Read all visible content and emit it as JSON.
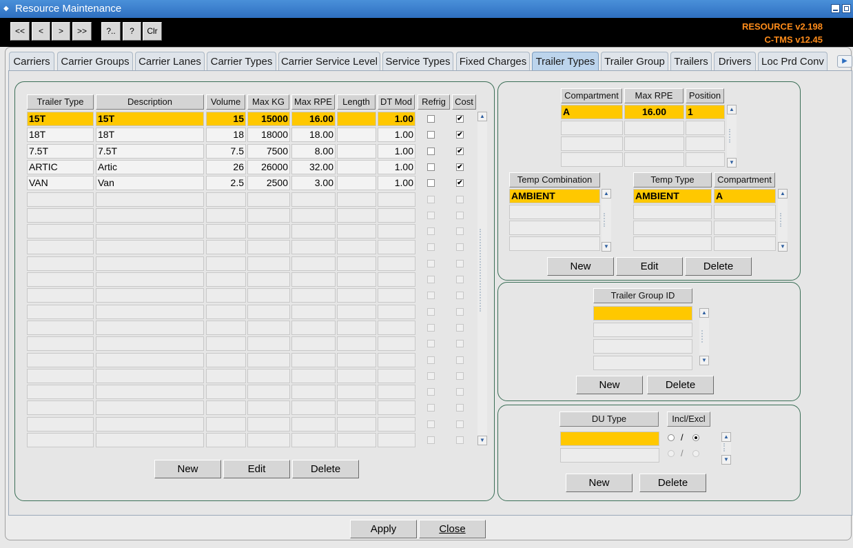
{
  "window": {
    "title": "Resource Maintenance"
  },
  "toolbar": {
    "buttons": [
      "<<",
      "<",
      ">",
      ">>",
      "?..",
      "?",
      "Clr"
    ],
    "version_line1": "RESOURCE v2.198",
    "version_line2": "C-TMS v12.45"
  },
  "tabs": [
    "Carriers",
    "Carrier Groups",
    "Carrier Lanes",
    "Carrier Types",
    "Carrier Service Level",
    "Service Types",
    "Fixed Charges",
    "Trailer Types",
    "Trailer Group",
    "Trailers",
    "Drivers",
    "Loc Prd Conv"
  ],
  "active_tab": "Trailer Types",
  "trailer_grid": {
    "headers": [
      "Trailer Type",
      "Description",
      "Volume",
      "Max KG",
      "Max RPE",
      "Length",
      "DT Mod",
      "Refrig",
      "Cost"
    ],
    "rows": [
      {
        "type": "15T",
        "description": "15T",
        "volume": "15",
        "max_kg": "15000",
        "max_rpe": "16.00",
        "length": "",
        "dt_mod": "1.00",
        "refrig": false,
        "cost": true
      },
      {
        "type": "18T",
        "description": "18T",
        "volume": "18",
        "max_kg": "18000",
        "max_rpe": "18.00",
        "length": "",
        "dt_mod": "1.00",
        "refrig": false,
        "cost": true
      },
      {
        "type": "7.5T",
        "description": "7.5T",
        "volume": "7.5",
        "max_kg": "7500",
        "max_rpe": "8.00",
        "length": "",
        "dt_mod": "1.00",
        "refrig": false,
        "cost": true
      },
      {
        "type": "ARTIC",
        "description": "Artic",
        "volume": "26",
        "max_kg": "26000",
        "max_rpe": "32.00",
        "length": "",
        "dt_mod": "1.00",
        "refrig": false,
        "cost": true
      },
      {
        "type": "VAN",
        "description": "Van",
        "volume": "2.5",
        "max_kg": "2500",
        "max_rpe": "3.00",
        "length": "",
        "dt_mod": "1.00",
        "refrig": false,
        "cost": true
      }
    ],
    "buttons": {
      "new": "New",
      "edit": "Edit",
      "delete": "Delete"
    }
  },
  "compartment_grid": {
    "headers": [
      "Compartment",
      "Max RPE",
      "Position"
    ],
    "rows": [
      {
        "compartment": "A",
        "max_rpe": "16.00",
        "position": "1"
      }
    ]
  },
  "temp_combination": {
    "header": "Temp Combination",
    "rows": [
      "AMBIENT"
    ]
  },
  "temp_type_grid": {
    "headers": [
      "Temp Type",
      "Compartment"
    ],
    "rows": [
      {
        "temp_type": "AMBIENT",
        "compartment": "A"
      }
    ]
  },
  "compartment_buttons": {
    "new": "New",
    "edit": "Edit",
    "delete": "Delete"
  },
  "trailer_group": {
    "header": "Trailer Group ID",
    "rows": [
      ""
    ],
    "buttons": {
      "new": "New",
      "delete": "Delete"
    }
  },
  "du_type": {
    "header": "DU Type",
    "incl_header": "Incl/Excl",
    "slash": "/",
    "rows": [
      {
        "du_type": "",
        "selected": "Excl"
      }
    ],
    "buttons": {
      "new": "New",
      "delete": "Delete"
    }
  },
  "footer": {
    "apply": "Apply",
    "close": "Close"
  },
  "colors": {
    "selection": "#ffc800",
    "title_bar": "#2e6fc0",
    "version_text": "#ff8c1a"
  }
}
